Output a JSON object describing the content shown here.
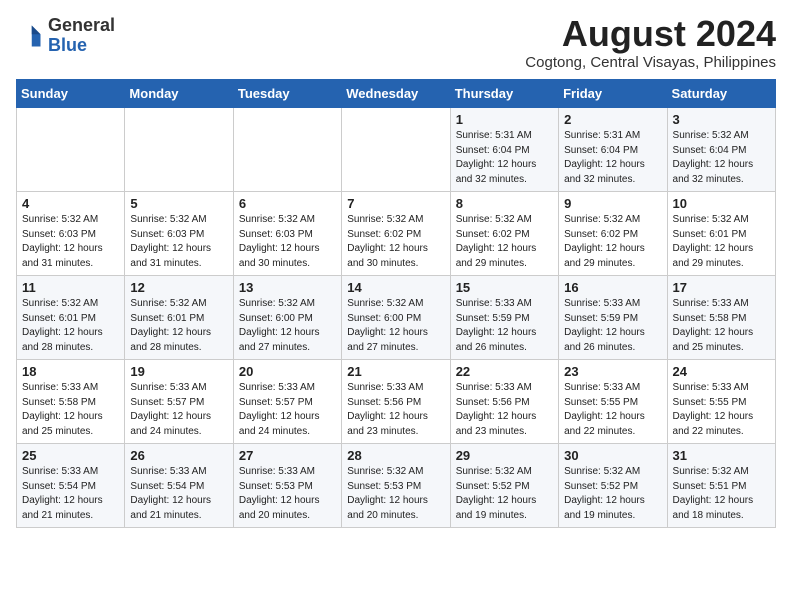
{
  "logo": {
    "general": "General",
    "blue": "Blue"
  },
  "title": "August 2024",
  "location": "Cogtong, Central Visayas, Philippines",
  "days_header": [
    "Sunday",
    "Monday",
    "Tuesday",
    "Wednesday",
    "Thursday",
    "Friday",
    "Saturday"
  ],
  "weeks": [
    [
      {
        "day": "",
        "content": ""
      },
      {
        "day": "",
        "content": ""
      },
      {
        "day": "",
        "content": ""
      },
      {
        "day": "",
        "content": ""
      },
      {
        "day": "1",
        "content": "Sunrise: 5:31 AM\nSunset: 6:04 PM\nDaylight: 12 hours\nand 32 minutes."
      },
      {
        "day": "2",
        "content": "Sunrise: 5:31 AM\nSunset: 6:04 PM\nDaylight: 12 hours\nand 32 minutes."
      },
      {
        "day": "3",
        "content": "Sunrise: 5:32 AM\nSunset: 6:04 PM\nDaylight: 12 hours\nand 32 minutes."
      }
    ],
    [
      {
        "day": "4",
        "content": "Sunrise: 5:32 AM\nSunset: 6:03 PM\nDaylight: 12 hours\nand 31 minutes."
      },
      {
        "day": "5",
        "content": "Sunrise: 5:32 AM\nSunset: 6:03 PM\nDaylight: 12 hours\nand 31 minutes."
      },
      {
        "day": "6",
        "content": "Sunrise: 5:32 AM\nSunset: 6:03 PM\nDaylight: 12 hours\nand 30 minutes."
      },
      {
        "day": "7",
        "content": "Sunrise: 5:32 AM\nSunset: 6:02 PM\nDaylight: 12 hours\nand 30 minutes."
      },
      {
        "day": "8",
        "content": "Sunrise: 5:32 AM\nSunset: 6:02 PM\nDaylight: 12 hours\nand 29 minutes."
      },
      {
        "day": "9",
        "content": "Sunrise: 5:32 AM\nSunset: 6:02 PM\nDaylight: 12 hours\nand 29 minutes."
      },
      {
        "day": "10",
        "content": "Sunrise: 5:32 AM\nSunset: 6:01 PM\nDaylight: 12 hours\nand 29 minutes."
      }
    ],
    [
      {
        "day": "11",
        "content": "Sunrise: 5:32 AM\nSunset: 6:01 PM\nDaylight: 12 hours\nand 28 minutes."
      },
      {
        "day": "12",
        "content": "Sunrise: 5:32 AM\nSunset: 6:01 PM\nDaylight: 12 hours\nand 28 minutes."
      },
      {
        "day": "13",
        "content": "Sunrise: 5:32 AM\nSunset: 6:00 PM\nDaylight: 12 hours\nand 27 minutes."
      },
      {
        "day": "14",
        "content": "Sunrise: 5:32 AM\nSunset: 6:00 PM\nDaylight: 12 hours\nand 27 minutes."
      },
      {
        "day": "15",
        "content": "Sunrise: 5:33 AM\nSunset: 5:59 PM\nDaylight: 12 hours\nand 26 minutes."
      },
      {
        "day": "16",
        "content": "Sunrise: 5:33 AM\nSunset: 5:59 PM\nDaylight: 12 hours\nand 26 minutes."
      },
      {
        "day": "17",
        "content": "Sunrise: 5:33 AM\nSunset: 5:58 PM\nDaylight: 12 hours\nand 25 minutes."
      }
    ],
    [
      {
        "day": "18",
        "content": "Sunrise: 5:33 AM\nSunset: 5:58 PM\nDaylight: 12 hours\nand 25 minutes."
      },
      {
        "day": "19",
        "content": "Sunrise: 5:33 AM\nSunset: 5:57 PM\nDaylight: 12 hours\nand 24 minutes."
      },
      {
        "day": "20",
        "content": "Sunrise: 5:33 AM\nSunset: 5:57 PM\nDaylight: 12 hours\nand 24 minutes."
      },
      {
        "day": "21",
        "content": "Sunrise: 5:33 AM\nSunset: 5:56 PM\nDaylight: 12 hours\nand 23 minutes."
      },
      {
        "day": "22",
        "content": "Sunrise: 5:33 AM\nSunset: 5:56 PM\nDaylight: 12 hours\nand 23 minutes."
      },
      {
        "day": "23",
        "content": "Sunrise: 5:33 AM\nSunset: 5:55 PM\nDaylight: 12 hours\nand 22 minutes."
      },
      {
        "day": "24",
        "content": "Sunrise: 5:33 AM\nSunset: 5:55 PM\nDaylight: 12 hours\nand 22 minutes."
      }
    ],
    [
      {
        "day": "25",
        "content": "Sunrise: 5:33 AM\nSunset: 5:54 PM\nDaylight: 12 hours\nand 21 minutes."
      },
      {
        "day": "26",
        "content": "Sunrise: 5:33 AM\nSunset: 5:54 PM\nDaylight: 12 hours\nand 21 minutes."
      },
      {
        "day": "27",
        "content": "Sunrise: 5:33 AM\nSunset: 5:53 PM\nDaylight: 12 hours\nand 20 minutes."
      },
      {
        "day": "28",
        "content": "Sunrise: 5:32 AM\nSunset: 5:53 PM\nDaylight: 12 hours\nand 20 minutes."
      },
      {
        "day": "29",
        "content": "Sunrise: 5:32 AM\nSunset: 5:52 PM\nDaylight: 12 hours\nand 19 minutes."
      },
      {
        "day": "30",
        "content": "Sunrise: 5:32 AM\nSunset: 5:52 PM\nDaylight: 12 hours\nand 19 minutes."
      },
      {
        "day": "31",
        "content": "Sunrise: 5:32 AM\nSunset: 5:51 PM\nDaylight: 12 hours\nand 18 minutes."
      }
    ]
  ]
}
